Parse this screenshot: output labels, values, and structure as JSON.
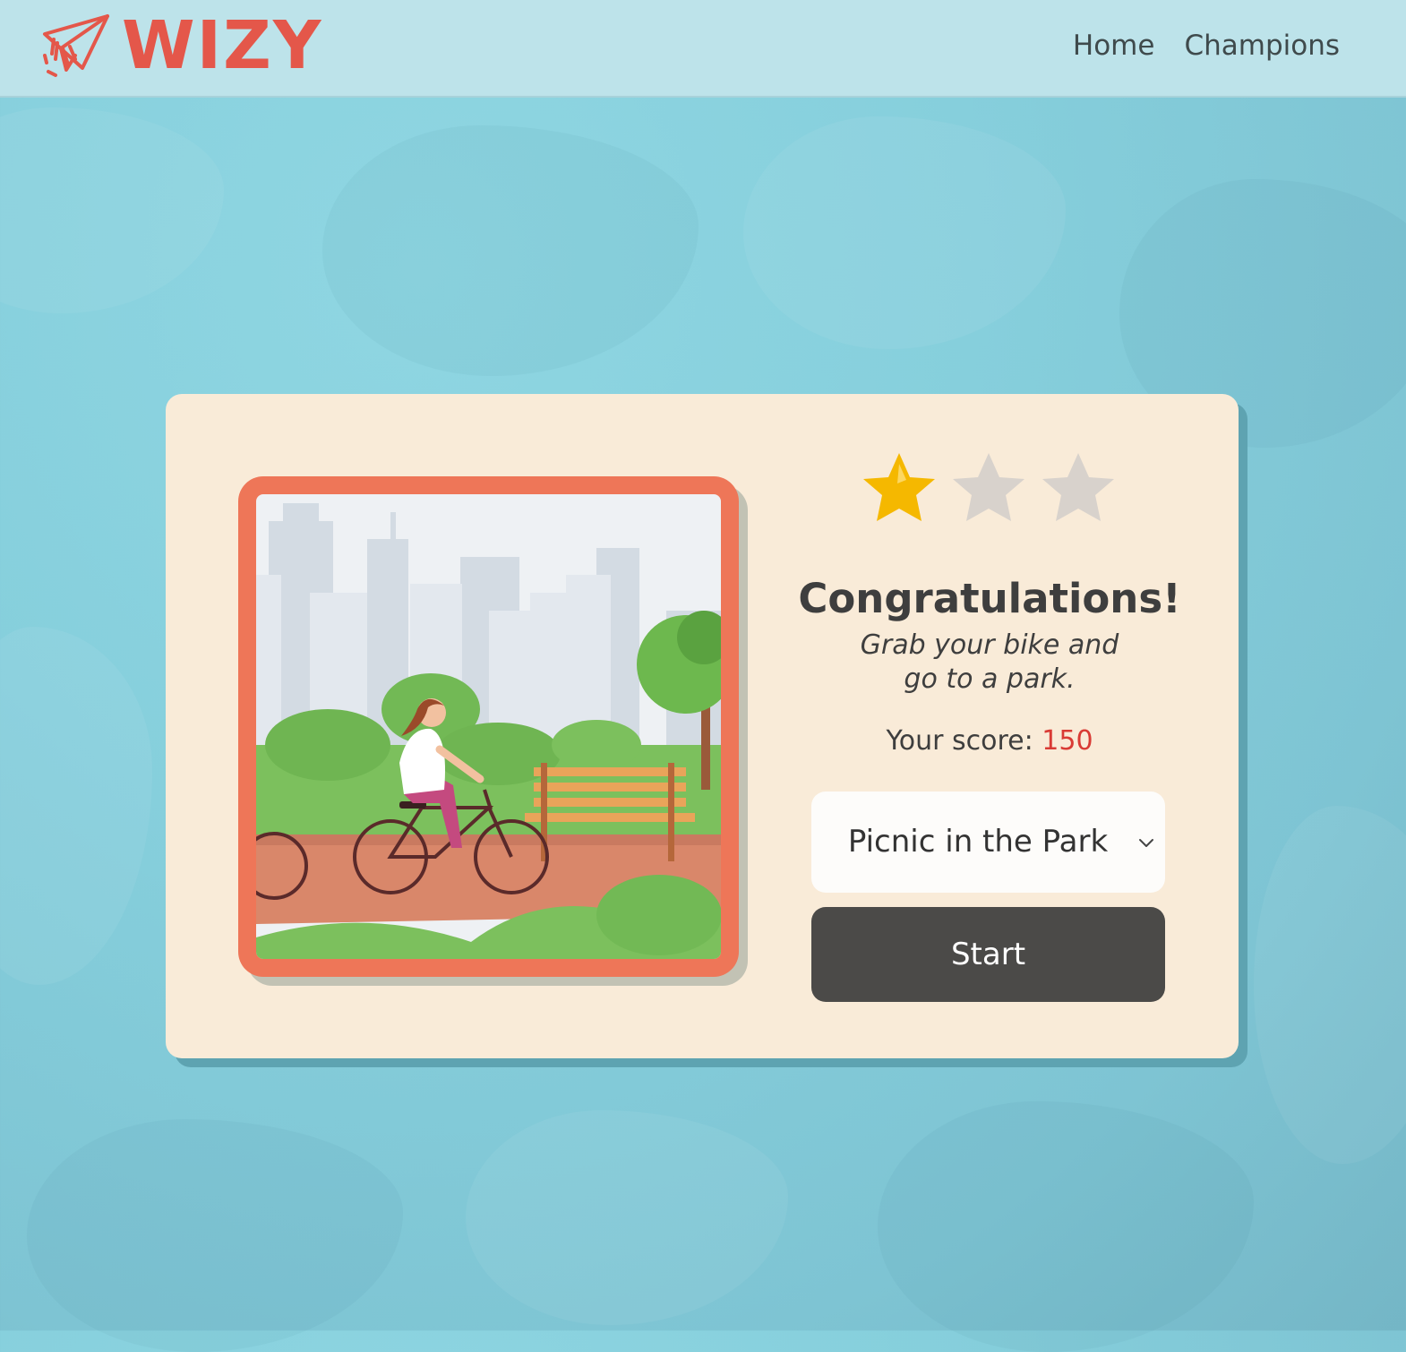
{
  "header": {
    "brand": "WIZY",
    "nav": [
      "Home",
      "Champions"
    ]
  },
  "result": {
    "stars_earned": 1,
    "stars_total": 3,
    "title": "Congratulations!",
    "subtitle_line1": "Grab your bike and",
    "subtitle_line2": "go to a park.",
    "score_label": "Your score:",
    "score_value": "150"
  },
  "level_select": {
    "selected": "Picnic in the Park"
  },
  "start_label": "Start",
  "icons": {
    "logo": "paper-plane-icon",
    "chevron": "chevron-down-icon",
    "star": "star-icon"
  },
  "colors": {
    "brand": "#e4574a",
    "score": "#d93b35",
    "frame": "#ee7658",
    "card": "#f9ebd8",
    "button": "#4b4a48",
    "star_filled": "#f5b800",
    "star_empty": "#d8d2cc"
  }
}
